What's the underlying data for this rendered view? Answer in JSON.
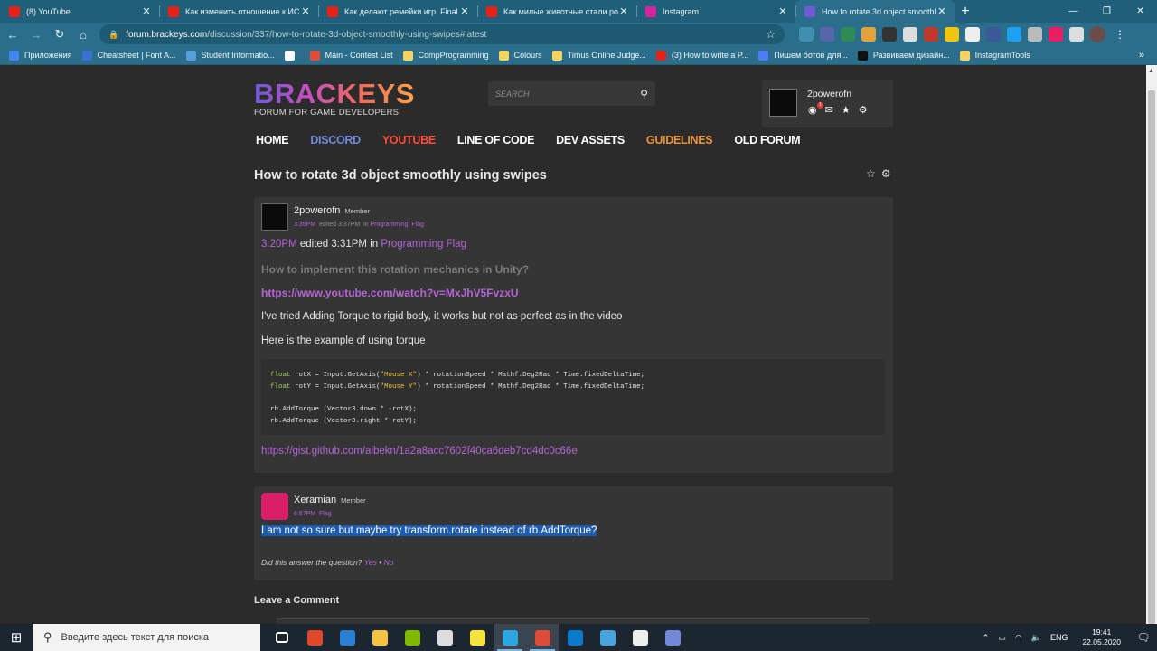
{
  "browser": {
    "tabs": [
      {
        "title": "(8) YouTube",
        "color": "#e62117",
        "active": false
      },
      {
        "title": "Как изменить отношение к ИСК",
        "color": "#e62117",
        "active": false
      },
      {
        "title": "Как делают ремейки игр. Final F",
        "color": "#e62117",
        "active": false
      },
      {
        "title": "Как милые животные стали рос",
        "color": "#e62117",
        "active": false
      },
      {
        "title": "Instagram",
        "color": "#d6249f",
        "active": false
      },
      {
        "title": "How to rotate 3d object smoothl",
        "color": "#6f5bd6",
        "active": true
      }
    ],
    "url_host": "forum.brackeys.com",
    "url_path": "/discussion/337/how-to-rotate-3d-object-smoothly-using-swipes#latest",
    "bookmarks": [
      {
        "label": "Приложения",
        "color": "#4285f4"
      },
      {
        "label": "Cheatsheet | Font A...",
        "color": "#3d6fd0"
      },
      {
        "label": "Student Informatio...",
        "color": "#55a0d8"
      },
      {
        "label": "",
        "color": "#ffffff"
      },
      {
        "label": "Main - Contest List",
        "color": "#e04e39"
      },
      {
        "label": "CompProgramming",
        "color": "#f4d35e"
      },
      {
        "label": "Colours",
        "color": "#f4d35e"
      },
      {
        "label": "Timus Online Judge...",
        "color": "#f4d35e"
      },
      {
        "label": "(3) How to write a P...",
        "color": "#e62117"
      },
      {
        "label": "Пишем ботов для...",
        "color": "#4f7cf0"
      },
      {
        "label": "Развиваем дизайн...",
        "color": "#111111"
      },
      {
        "label": "InstagramTools",
        "color": "#f4d35e"
      }
    ]
  },
  "site": {
    "logo": "BRACKEYS",
    "tagline": "FORUM FOR GAME DEVELOPERS",
    "search_placeholder": "SEARCH",
    "user": {
      "name": "2powerofn",
      "badge": "1"
    },
    "nav": [
      {
        "label": "HOME",
        "color": "#ffffff"
      },
      {
        "label": "DISCORD",
        "color": "#7289da"
      },
      {
        "label": "YOUTUBE",
        "color": "#ff4b3a"
      },
      {
        "label": "LINE OF CODE",
        "color": "#ffffff"
      },
      {
        "label": "DEV ASSETS",
        "color": "#ffffff"
      },
      {
        "label": "GUIDELINES",
        "color": "#e8943a"
      },
      {
        "label": "OLD FORUM",
        "color": "#ffffff"
      }
    ]
  },
  "discussion": {
    "title": "How to rotate 3d object smoothly using swipes",
    "post1": {
      "author": "2powerofn",
      "role": "Member",
      "time": "3:35PM",
      "edited": "edited 3:37PM",
      "in": "in",
      "category": "Programming",
      "flag": "Flag",
      "body_time": "3:20PM",
      "body_edited": "edited 3:31PM in",
      "body_category": "Programming",
      "body_flag": "Flag",
      "question": "How to implement this rotation mechanics in Unity?",
      "video_link": "https://www.youtube.com/watch?v=MxJhV5FvzxU",
      "text1": "I've tried Adding Torque to rigid body, it works but not as perfect as in the video",
      "text2": "Here is the example of using torque",
      "code": {
        "l1_kw": "float",
        "l1_a": " rotX = Input.GetAxis(",
        "l1_str": "\"Mouse X\"",
        "l1_b": ") * rotationSpeed * Mathf.Deg2Rad * Time.fixedDeltaTime;",
        "l2_kw": "float",
        "l2_a": " rotY = Input.GetAxis(",
        "l2_str": "\"Mouse Y\"",
        "l2_b": ") * rotationSpeed * Mathf.Deg2Rad * Time.fixedDeltaTime;",
        "l3": "rb.AddTorque (Vector3.down * -rotX);",
        "l4": "rb.AddTorque (Vector3.right * rotY);"
      },
      "gist_link": "https://gist.github.com/aibekn/1a2a8acc7602f40ca6deb7cd4dc0c66e"
    },
    "post2": {
      "author": "Xeramian",
      "role": "Member",
      "time": "6:57PM",
      "flag": "Flag",
      "text": "I am not so sure but maybe try transform.rotate instead of rb.AddTorque?",
      "did_answer": "Did this answer the question?",
      "yes": "Yes",
      "sep": "•",
      "no": "No"
    },
    "leave_comment": "Leave a Comment"
  },
  "taskbar": {
    "search_placeholder": "Введите здесь текст для поиска",
    "lang": "ENG",
    "time": "19:41",
    "date": "22.05.2020",
    "apps": [
      {
        "name": "task-view-icon",
        "color": "#ffffff"
      },
      {
        "name": "game-app-icon",
        "color": "#e0482c"
      },
      {
        "name": "mail-icon",
        "color": "#2a7fd4"
      },
      {
        "name": "file-explorer-icon",
        "color": "#f5c342"
      },
      {
        "name": "office-icon",
        "color": "#7fba00"
      },
      {
        "name": "unity-hub-icon",
        "color": "#dddddd"
      },
      {
        "name": "sticky-notes-icon",
        "color": "#f6e43a"
      },
      {
        "name": "telegram-icon",
        "color": "#2ca5e0"
      },
      {
        "name": "chrome-icon",
        "color": "#dd4b39"
      },
      {
        "name": "vscode-icon",
        "color": "#0a7acc"
      },
      {
        "name": "notepad-icon",
        "color": "#4aa3df"
      },
      {
        "name": "unity-icon",
        "color": "#eeeeee"
      },
      {
        "name": "discord-icon",
        "color": "#7289da"
      }
    ]
  }
}
